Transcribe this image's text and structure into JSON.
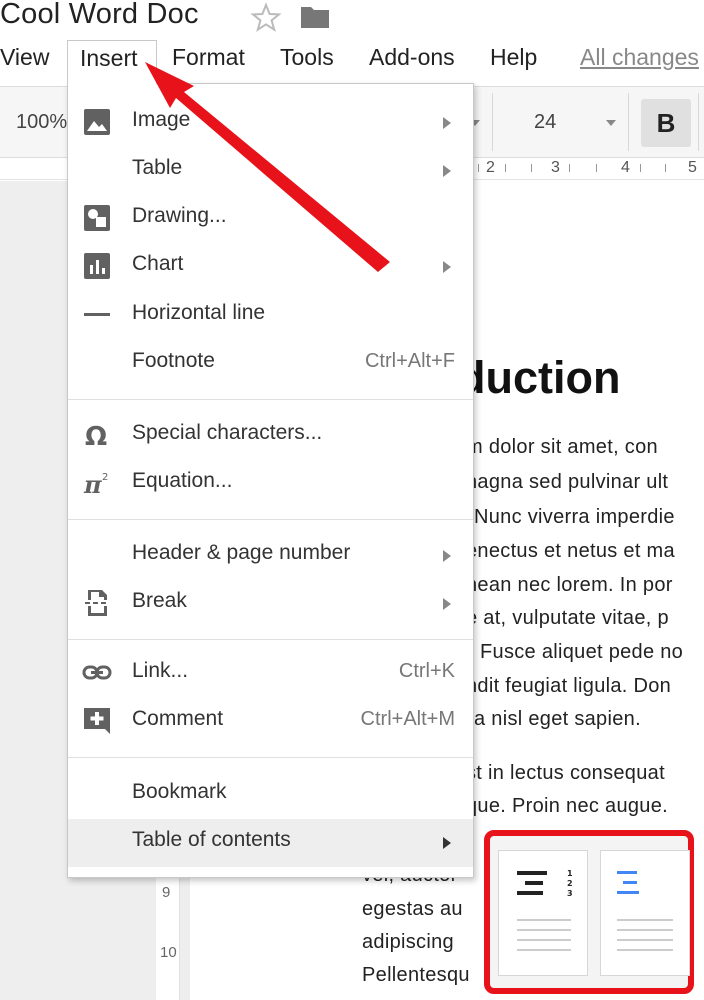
{
  "window": {
    "doc_title": "Cool Word Doc"
  },
  "menubar": {
    "view": "View",
    "insert": "Insert",
    "format": "Format",
    "tools": "Tools",
    "addons": "Add-ons",
    "help": "Help",
    "all_changes": "All changes"
  },
  "toolbar": {
    "zoom": "100%",
    "font_size": "24",
    "bold": "B"
  },
  "ruler": {
    "ticks": [
      "2",
      "3",
      "4",
      "5"
    ]
  },
  "vruler": {
    "ticks": [
      "9",
      "10"
    ]
  },
  "insert_menu": {
    "items": [
      {
        "label": "Image",
        "icon": "image-icon",
        "submenu": true,
        "shortcut": ""
      },
      {
        "label": "Table",
        "icon": "",
        "submenu": true,
        "shortcut": ""
      },
      {
        "label": "Drawing...",
        "icon": "drawing-icon",
        "submenu": false,
        "shortcut": ""
      },
      {
        "label": "Chart",
        "icon": "chart-icon",
        "submenu": true,
        "shortcut": ""
      },
      {
        "label": "Horizontal line",
        "icon": "horizontal-line-icon",
        "submenu": false,
        "shortcut": ""
      },
      {
        "label": "Footnote",
        "icon": "",
        "submenu": false,
        "shortcut": "Ctrl+Alt+F"
      },
      {
        "label": "Special characters...",
        "icon": "omega-icon",
        "submenu": false,
        "shortcut": ""
      },
      {
        "label": "Equation...",
        "icon": "pi-icon",
        "submenu": false,
        "shortcut": ""
      },
      {
        "label": "Header & page number",
        "icon": "",
        "submenu": true,
        "shortcut": ""
      },
      {
        "label": "Break",
        "icon": "page-break-icon",
        "submenu": true,
        "shortcut": ""
      },
      {
        "label": "Link...",
        "icon": "link-icon",
        "submenu": false,
        "shortcut": "Ctrl+K"
      },
      {
        "label": "Comment",
        "icon": "comment-icon",
        "submenu": false,
        "shortcut": "Ctrl+Alt+M"
      },
      {
        "label": "Bookmark",
        "icon": "",
        "submenu": false,
        "shortcut": ""
      },
      {
        "label": "Table of contents",
        "icon": "",
        "submenu": true,
        "shortcut": "",
        "highlighted": true
      }
    ]
  },
  "document": {
    "heading": "duction",
    "lines": [
      "m dolor sit amet, con",
      "nagna sed pulvinar ult",
      "Nunc viverra imperdie",
      "enectus et netus et ma",
      "nean nec lorem. In por",
      "e at, vulputate vitae, p",
      "Fusce aliquet pede no",
      "ndit feugiat ligula. Don",
      "a nisl eget sapien.",
      "st in lectus consequat",
      "que. Proin nec augue.",
      "vel, auctor",
      "egestas au",
      "adipiscing",
      "Pellentesqu"
    ]
  },
  "colors": {
    "arrow_red": "#e8131a",
    "toc_blue": "#4285f4",
    "menu_highlight": "#eeeeee"
  }
}
